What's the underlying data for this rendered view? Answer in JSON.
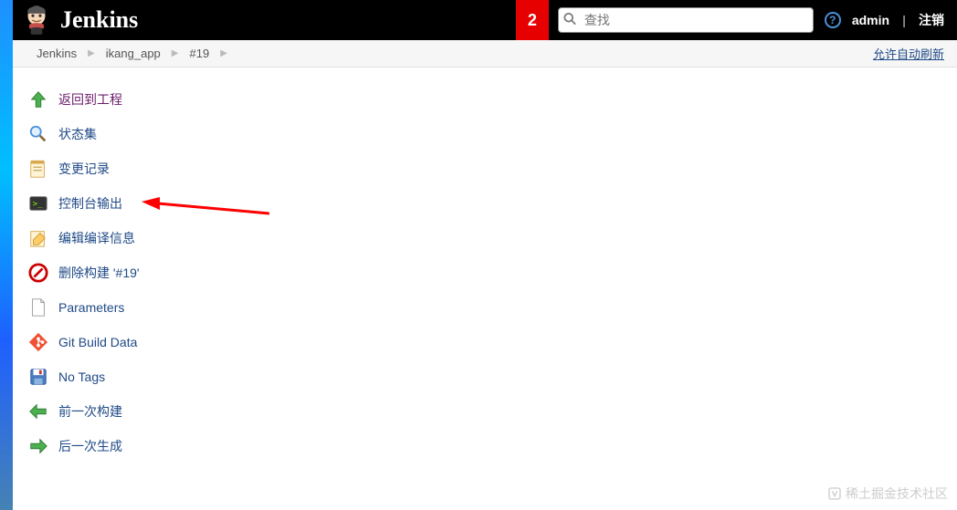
{
  "header": {
    "brand": "Jenkins",
    "notification_count": "2",
    "search_placeholder": "查找",
    "user": "admin",
    "logout": "注销"
  },
  "breadcrumb": {
    "items": [
      "Jenkins",
      "ikang_app",
      "#19"
    ],
    "auto_refresh": "允许自动刷新"
  },
  "sidebar": {
    "items": [
      {
        "label": "返回到工程",
        "icon": "up-arrow-icon",
        "special": true
      },
      {
        "label": "状态集",
        "icon": "magnifier-icon"
      },
      {
        "label": "变更记录",
        "icon": "notepad-icon"
      },
      {
        "label": "控制台输出",
        "icon": "terminal-icon"
      },
      {
        "label": "编辑编译信息",
        "icon": "edit-info-icon"
      },
      {
        "label": "删除构建 '#19'",
        "icon": "delete-icon"
      },
      {
        "label": "Parameters",
        "icon": "document-icon"
      },
      {
        "label": "Git Build Data",
        "icon": "git-icon"
      },
      {
        "label": "No Tags",
        "icon": "save-icon"
      },
      {
        "label": "前一次构建",
        "icon": "left-arrow-icon"
      },
      {
        "label": "后一次生成",
        "icon": "right-arrow-icon"
      }
    ]
  },
  "watermark": "稀土掘金技术社区"
}
